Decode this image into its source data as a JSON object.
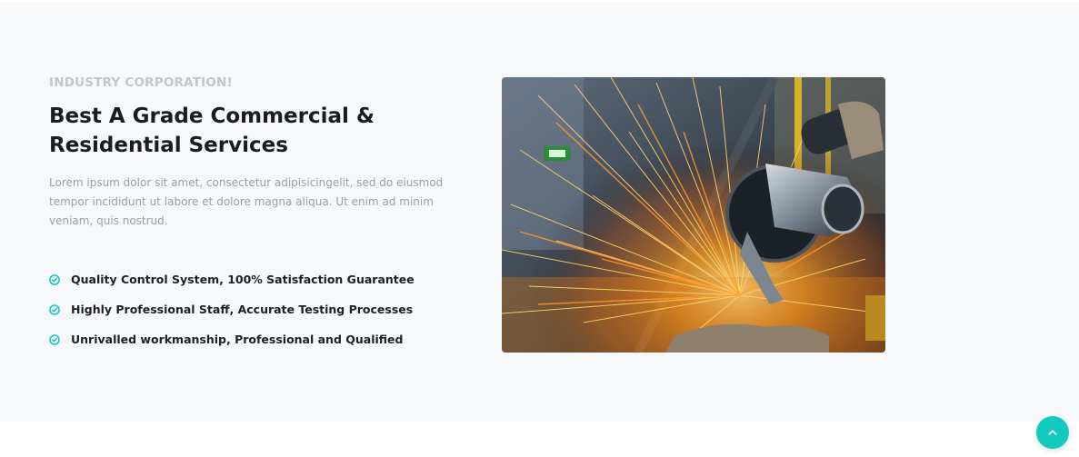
{
  "about": {
    "eyebrow": "INDUSTRY CORPORATION!",
    "title": "Best A Grade Commercial & Residential Services",
    "description": "Lorem ipsum dolor sit amet, consectetur adipisicingelit, sed do eiusmod tempor incididunt ut labore et dolore magna aliqua. Ut enim ad minim veniam, quis nostrud.",
    "features": [
      "Quality Control System, 100% Satisfaction Guarantee",
      "Highly Professional Staff, Accurate Testing Processes",
      "Unrivalled workmanship, Professional and Qualified"
    ],
    "feature_icon": "check-circle-icon"
  },
  "media": {
    "image_subject": "angle-grinder-sparks-photo"
  },
  "scroll_top": {
    "icon": "chevron-up-icon"
  },
  "colors": {
    "accent": "#14c9c0",
    "heading": "#1b1c22",
    "muted": "#9aa0a6",
    "eyebrow": "#c2c5ca",
    "section_bg": "#f7f8fa"
  }
}
